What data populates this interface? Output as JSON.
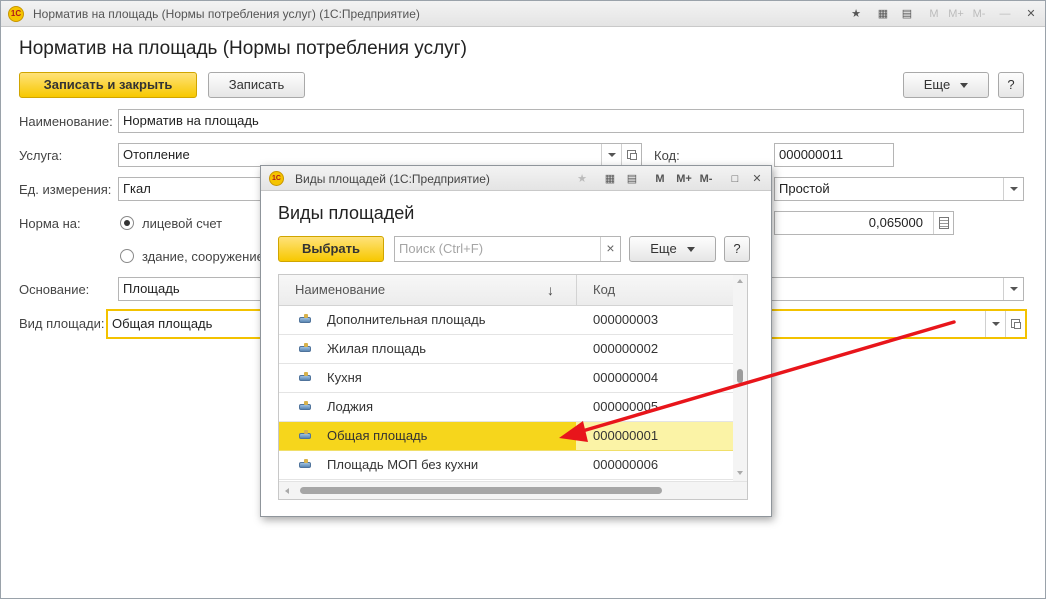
{
  "main": {
    "window_title": "Норматив на площадь (Нормы потребления услуг)  (1С:Предприятие)",
    "logo": "1С",
    "form_title": "Норматив на площадь (Нормы потребления услуг)",
    "buttons": {
      "save_close": "Записать и закрыть",
      "save": "Записать",
      "more": "Еще",
      "help": "?"
    },
    "title_controls": {
      "m": "M",
      "m_plus": "M+",
      "m_minus": "M-",
      "minimize": "—",
      "maximize": "□",
      "close": "✕"
    },
    "fields": {
      "name_label": "Наименование:",
      "name_value": "Норматив на площадь",
      "service_label": "Услуга:",
      "service_value": "Отопление",
      "code_label": "Код:",
      "code_value": "000000011",
      "unit_label": "Ед. измерения:",
      "unit_value": "Гкал",
      "type_value": "Простой",
      "norm_label": "Норма на:",
      "radio_account": "лицевой счет",
      "radio_building": "здание, сооружение",
      "norm_value": "0,065000",
      "basis_label": "Основание:",
      "basis_value": "Площадь",
      "area_kind_label": "Вид площади:",
      "area_kind_value": "Общая площадь"
    }
  },
  "popup": {
    "window_title": "Виды площадей  (1С:Предприятие)",
    "logo": "1С",
    "heading": "Виды площадей",
    "select_button": "Выбрать",
    "search_placeholder": "Поиск (Ctrl+F)",
    "clear_search": "×",
    "more_button": "Еще",
    "help_button": "?",
    "title_controls": {
      "m": "M",
      "m_plus": "M+",
      "m_minus": "M-",
      "maximize": "□",
      "close": "✕"
    },
    "columns": {
      "name": "Наименование",
      "sort": "↓",
      "code": "Код"
    },
    "rows": [
      {
        "name": "Дополнительная площадь",
        "code": "000000003"
      },
      {
        "name": "Жилая площадь",
        "code": "000000002"
      },
      {
        "name": "Кухня",
        "code": "000000004"
      },
      {
        "name": "Лоджия",
        "code": "000000005"
      },
      {
        "name": "Общая площадь",
        "code": "000000001",
        "selected": true
      },
      {
        "name": "Площадь МОП без кухни",
        "code": "000000006"
      }
    ]
  },
  "colors": {
    "accent_yellow": "#f6d61c",
    "selected_row": "#fbf3a6",
    "focus_border": "#f3c200",
    "annotation_arrow": "#e8151b"
  }
}
